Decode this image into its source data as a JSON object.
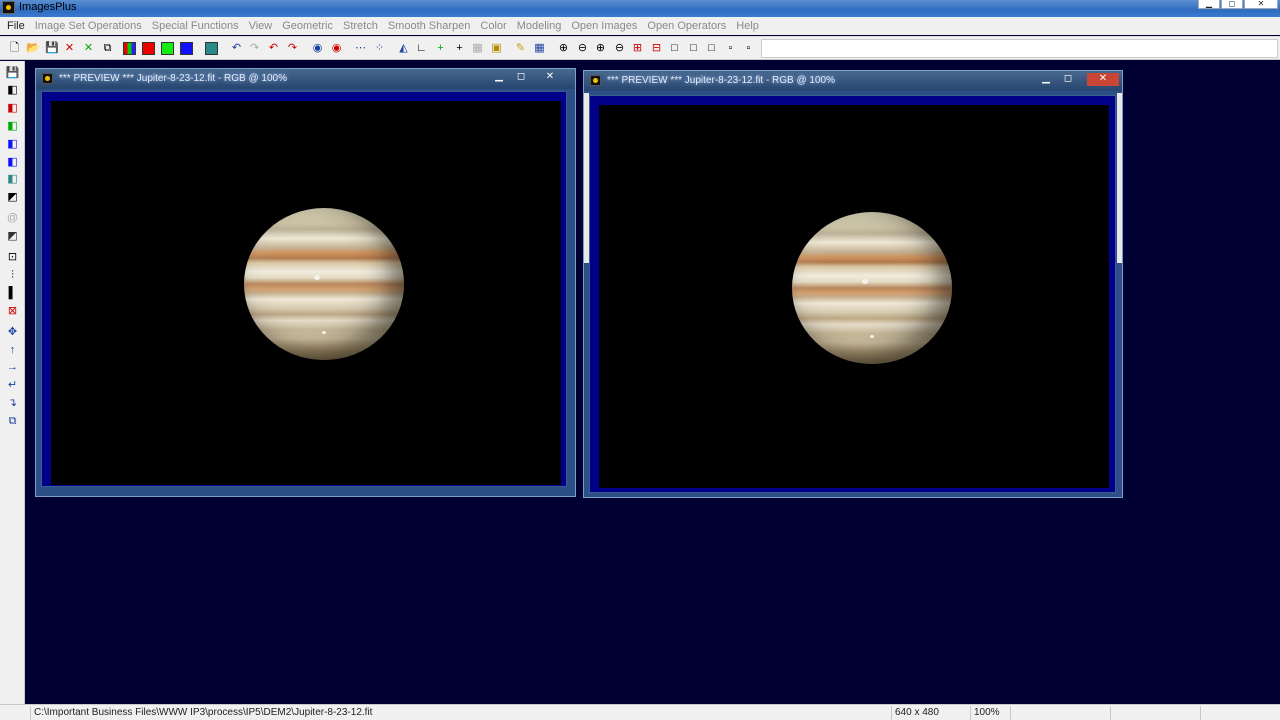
{
  "app": {
    "title": "ImagesPlus"
  },
  "menu": [
    {
      "label": "File",
      "enabled": true
    },
    {
      "label": "Image Set Operations",
      "enabled": false
    },
    {
      "label": "Special Functions",
      "enabled": false
    },
    {
      "label": "View",
      "enabled": false
    },
    {
      "label": "Geometric",
      "enabled": false
    },
    {
      "label": "Stretch",
      "enabled": false
    },
    {
      "label": "Smooth Sharpen",
      "enabled": false
    },
    {
      "label": "Color",
      "enabled": false
    },
    {
      "label": "Modeling",
      "enabled": false
    },
    {
      "label": "Open Images",
      "enabled": false
    },
    {
      "label": "Open Operators",
      "enabled": false
    },
    {
      "label": "Help",
      "enabled": false
    }
  ],
  "windows": [
    {
      "title": "*** PREVIEW *** Jupiter-8-23-12.fit - RGB @ 100%"
    },
    {
      "title": "*** PREVIEW *** Jupiter-8-23-12.fit - RGB @ 100%"
    }
  ],
  "status": {
    "path": "C:\\Important Business Files\\WWW IP3\\process\\IP5\\DEM2\\Jupiter-8-23-12.fit",
    "dimensions": "640 x 480",
    "zoom": "100%"
  },
  "colors": {
    "mdi_background": "#000033",
    "image_frame": "#00008a",
    "titlebar": "#2f6cc0"
  }
}
